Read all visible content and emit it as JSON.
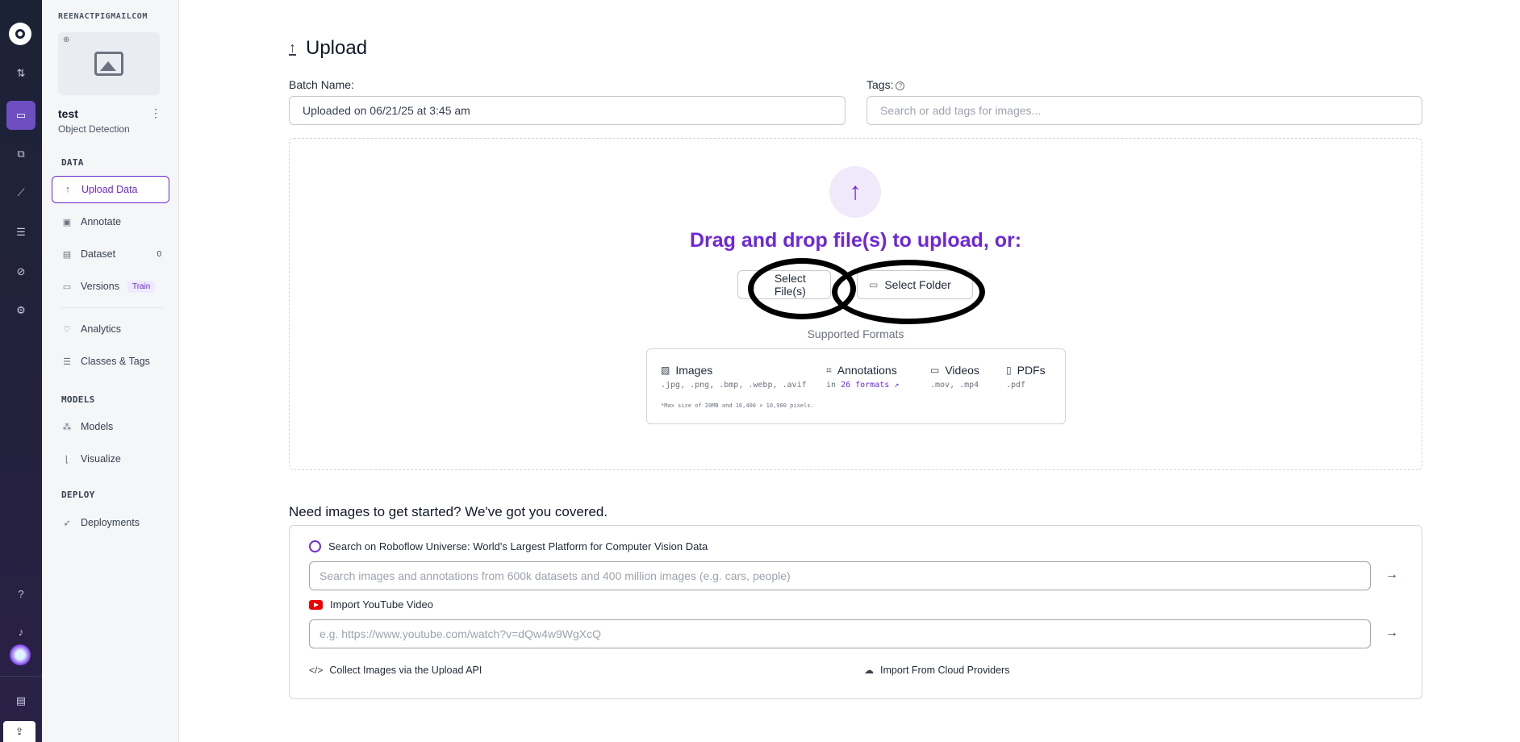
{
  "rail": {
    "icons": [
      "roboflow-logo-icon",
      "transfer-icon",
      "inbox-icon",
      "hierarchy-icon",
      "chart-icon",
      "storage-icon",
      "plugin-icon",
      "gear-icon",
      "help-icon",
      "bell-icon",
      "avatar",
      "book-icon",
      "upload-icon"
    ]
  },
  "sidebar": {
    "workspace": "REENACTPIGMAILCOM",
    "project_name": "test",
    "project_type": "Object Detection",
    "sections": {
      "data": "DATA",
      "models": "MODELS",
      "deploy": "DEPLOY"
    },
    "items": [
      {
        "label": "Upload Data",
        "icon": "↑"
      },
      {
        "label": "Annotate",
        "icon": "▣"
      },
      {
        "label": "Dataset",
        "icon": "▤",
        "badge": "0"
      },
      {
        "label": "Versions",
        "icon": "▭",
        "badge": "Train"
      },
      {
        "label": "Analytics",
        "icon": "♡"
      },
      {
        "label": "Classes & Tags",
        "icon": "☰"
      },
      {
        "label": "Models",
        "icon": "⁂"
      },
      {
        "label": "Visualize",
        "icon": "⌊"
      },
      {
        "label": "Deployments",
        "icon": "➶"
      }
    ]
  },
  "main": {
    "title": "Upload",
    "batch_label": "Batch Name:",
    "batch_value": "Uploaded on 06/21/25 at 3:45 am",
    "tags_label": "Tags:",
    "tags_placeholder": "Search or add tags for images...",
    "drag_text": "Drag and drop file(s) to upload, or:",
    "select_files": "Select File(s)",
    "select_folder": "Select Folder",
    "supported_title": "Supported Formats",
    "formats": [
      {
        "name": "Images",
        "sub": ".jpg, .png, .bmp, .webp, .avif"
      },
      {
        "name": "Annotations",
        "sub_prefix": "in ",
        "sub_link": "26 formats ↗"
      },
      {
        "name": "Videos",
        "sub": ".mov, .mp4"
      },
      {
        "name": "PDFs",
        "sub": ".pdf"
      }
    ],
    "formats_note": "*Max size of 20MB and 16,400 × 10,900 pixels.",
    "need_images": "Need images to get started? We've got you covered.",
    "universe_label": "Search on Roboflow Universe: World's Largest Platform for Computer Vision Data",
    "universe_placeholder": "Search images and annotations from 600k datasets and 400 million images (e.g. cars, people)",
    "youtube_label": "Import YouTube Video",
    "youtube_placeholder": "e.g. https://www.youtube.com/watch?v=dQw4w9WgXcQ",
    "api_link": "Collect Images via the Upload API",
    "cloud_link": "Import From Cloud Providers"
  }
}
